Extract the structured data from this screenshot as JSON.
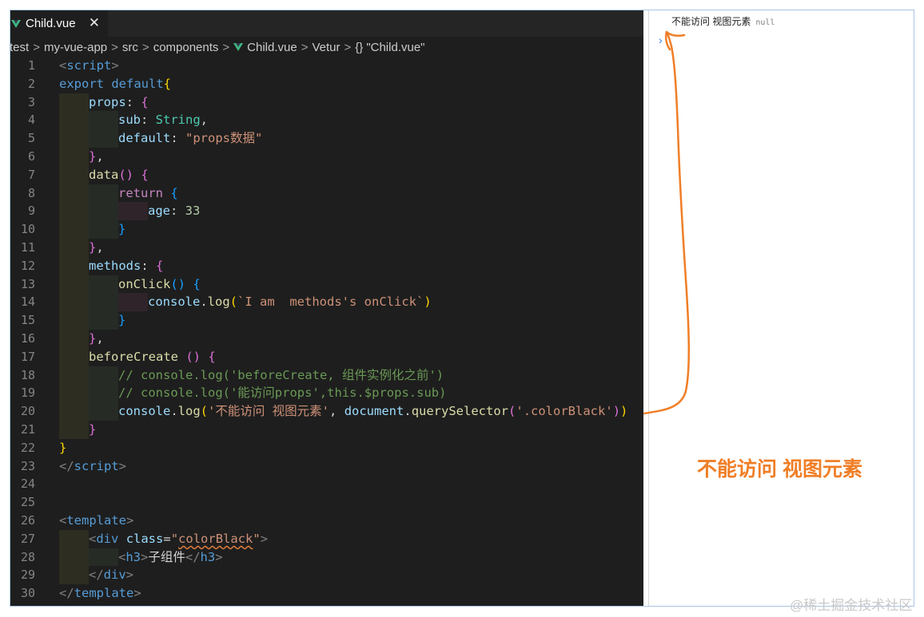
{
  "tab": {
    "icon": "vue-icon",
    "title": "Child.vue",
    "close_glyph": "✕"
  },
  "breadcrumb": {
    "items": [
      "test",
      "my-vue-app",
      "src",
      "components",
      "Child.vue",
      "Vetur",
      "\"Child.vue\""
    ],
    "separator": ">",
    "braces": "{}"
  },
  "code": {
    "line_numbers": [
      "1",
      "2",
      "3",
      "4",
      "5",
      "6",
      "7",
      "8",
      "9",
      "10",
      "11",
      "12",
      "13",
      "14",
      "15",
      "16",
      "17",
      "18",
      "19",
      "20",
      "21",
      "22",
      "23",
      "24",
      "25",
      "26",
      "27",
      "28",
      "29",
      "30"
    ],
    "lines": {
      "l1": [
        "<",
        "script",
        ">"
      ],
      "l2": [
        "export",
        " ",
        "default",
        "{"
      ],
      "l3": [
        "props",
        ": ",
        "{"
      ],
      "l4": [
        "sub",
        ": ",
        "String",
        ","
      ],
      "l5": [
        "default",
        ": ",
        "\"props数据\""
      ],
      "l6": [
        "}",
        ","
      ],
      "l7": [
        "data",
        "()",
        " ",
        "{"
      ],
      "l8": [
        "return",
        " ",
        "{"
      ],
      "l9": [
        "age",
        ": ",
        "33"
      ],
      "l10": [
        "}"
      ],
      "l11": [
        "}",
        ","
      ],
      "l12": [
        "methods",
        ": ",
        "{"
      ],
      "l13": [
        "onClick",
        "()",
        " ",
        "{"
      ],
      "l14": [
        "console",
        ".",
        "log",
        "(",
        "`I am  methods's onClick`",
        ")"
      ],
      "l15": [
        "}"
      ],
      "l16": [
        "}",
        ","
      ],
      "l17": [
        "beforeCreate",
        " ",
        "()",
        " ",
        "{"
      ],
      "l18": [
        "// console.log('beforeCreate, 组件实例化之前')"
      ],
      "l19": [
        "// console.log('能访问props',this.$props.sub)"
      ],
      "l20": [
        "console",
        ".",
        "log",
        "(",
        "'不能访问 视图元素'",
        ", ",
        "document",
        ".",
        "querySelector",
        "(",
        "'.colorBlack'",
        ")",
        ")"
      ],
      "l21": [
        "}"
      ],
      "l22": [
        "}"
      ],
      "l23": [
        "</",
        "script",
        ">"
      ],
      "l24": [],
      "l25": [],
      "l26": [
        "<",
        "template",
        ">"
      ],
      "l27": [
        "<",
        "div",
        " ",
        "class",
        "=",
        "\"",
        "colorBlack",
        "\"",
        ">"
      ],
      "l28": [
        "<",
        "h3",
        ">",
        "子组件",
        "</",
        "h3",
        ">"
      ],
      "l29": [
        "</",
        "div",
        ">"
      ],
      "l30": [
        "</",
        "template",
        ">"
      ]
    }
  },
  "console": {
    "message": "不能访问 视图元素",
    "value": "null",
    "prompt": "›"
  },
  "annotation": {
    "text": "不能访问 视图元素",
    "color": "#f07e26"
  },
  "watermark": "@稀土掘金技术社区",
  "colors": {
    "editor_bg": "#1e1e1e",
    "accent_orange": "#f07e26",
    "tab_border": "#3c8bd6"
  }
}
